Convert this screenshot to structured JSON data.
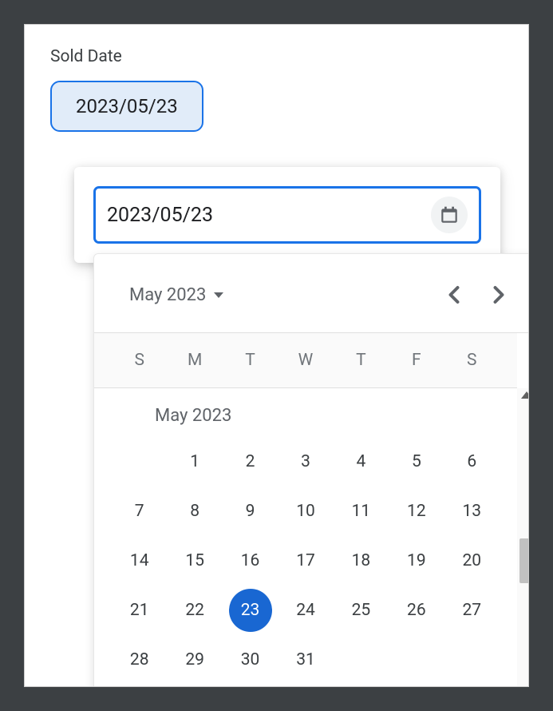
{
  "field": {
    "label": "Sold Date",
    "value_display": "2023/05/23"
  },
  "input": {
    "value": "2023/05/23"
  },
  "calendar": {
    "header_month": "May 2023",
    "month_title": "May 2023",
    "weekdays": [
      "S",
      "M",
      "T",
      "W",
      "T",
      "F",
      "S"
    ],
    "selected_day": 23,
    "first_weekday_index": 1,
    "num_days": 31
  },
  "colors": {
    "primary": "#1a73e8",
    "chip_bg": "#e1ecf9",
    "text_muted": "#5f6368"
  }
}
